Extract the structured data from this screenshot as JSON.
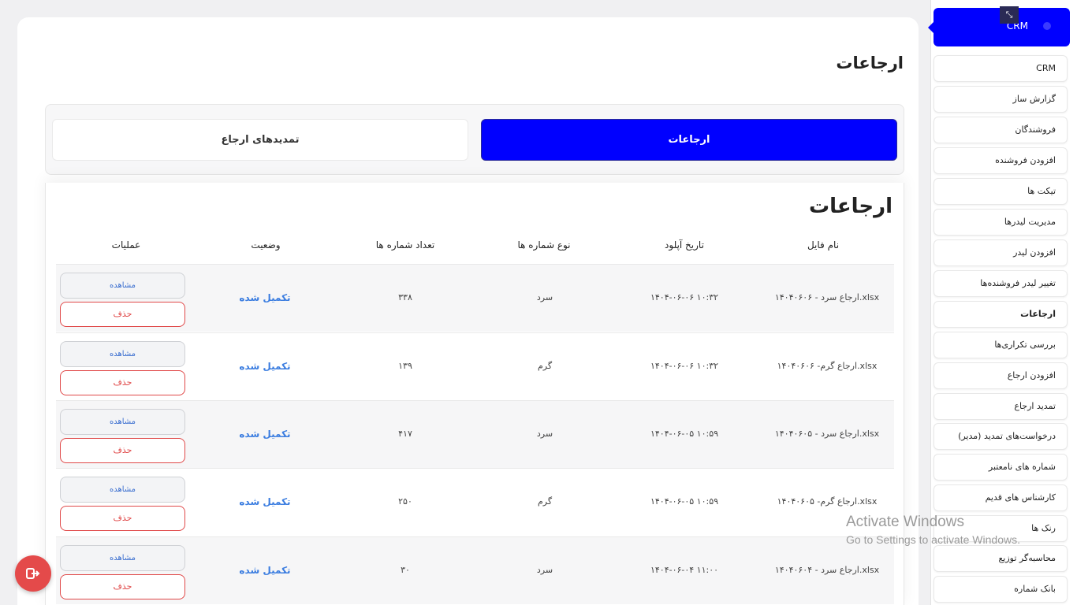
{
  "sidebar": {
    "header_label": "CRM",
    "items": [
      {
        "label": "CRM",
        "active": false
      },
      {
        "label": "گزارش ساز",
        "active": false
      },
      {
        "label": "فروشندگان",
        "active": false
      },
      {
        "label": "افزودن فروشنده",
        "active": false
      },
      {
        "label": "تیکت ها",
        "active": false
      },
      {
        "label": "مدیریت لیدرها",
        "active": false
      },
      {
        "label": "افزودن لیدر",
        "active": false
      },
      {
        "label": "تغییر لیدر فروشنده‌ها",
        "active": false
      },
      {
        "label": "ارجاعات",
        "active": true
      },
      {
        "label": "بررسی تکراری‌ها",
        "active": false
      },
      {
        "label": "افزودن ارجاع",
        "active": false
      },
      {
        "label": "تمدید ارجاع",
        "active": false
      },
      {
        "label": "درخواست‌های تمدید (مدیر)",
        "active": false
      },
      {
        "label": "شماره های نامعتبر",
        "active": false
      },
      {
        "label": "کارشناس های قدیم",
        "active": false
      },
      {
        "label": "رنک ها",
        "active": false
      },
      {
        "label": "محاسبه‌گر توزیع",
        "active": false
      },
      {
        "label": "بانک شماره",
        "active": false
      }
    ]
  },
  "page": {
    "title": "ارجاعات"
  },
  "tabs": {
    "active": "ارجاعات",
    "inactive": "تمدیدهای ارجاع"
  },
  "table": {
    "title": "ارجاعات",
    "headers": {
      "file_name": "نام فایل",
      "upload_date": "تاریخ آپلود",
      "number_type": "نوع شماره ها",
      "number_count": "تعداد شماره ها",
      "status": "وضعیت",
      "actions": "عملیات"
    },
    "rows": [
      {
        "file_name": "ارجاع سرد - ۱۴۰۴۰۶۰۶.xlsx",
        "upload_date": "۱۴۰۴-۰۶-۰۶ ۱۰:۳۲",
        "number_type": "سرد",
        "number_count": "۳۳۸",
        "status": "تکمیل شده",
        "view": "مشاهده",
        "delete": "حذف"
      },
      {
        "file_name": "ارجاع گرم- ۱۴۰۴۰۶۰۶.xlsx",
        "upload_date": "۱۴۰۴-۰۶-۰۶ ۱۰:۳۲",
        "number_type": "گرم",
        "number_count": "۱۳۹",
        "status": "تکمیل شده",
        "view": "مشاهده",
        "delete": "حذف"
      },
      {
        "file_name": "ارجاع سرد - ۱۴۰۴۰۶۰۵.xlsx",
        "upload_date": "۱۴۰۴-۰۶-۰۵ ۱۰:۵۹",
        "number_type": "سرد",
        "number_count": "۴۱۷",
        "status": "تکمیل شده",
        "view": "مشاهده",
        "delete": "حذف"
      },
      {
        "file_name": "ارجاع گرم- ۱۴۰۴۰۶۰۵.xlsx",
        "upload_date": "۱۴۰۴-۰۶-۰۵ ۱۰:۵۹",
        "number_type": "گرم",
        "number_count": "۲۵۰",
        "status": "تکمیل شده",
        "view": "مشاهده",
        "delete": "حذف"
      },
      {
        "file_name": "ارجاع سرد - ۱۴۰۴۰۶۰۴.xlsx",
        "upload_date": "۱۴۰۴-۰۶-۰۴ ۱۱:۰۰",
        "number_type": "سرد",
        "number_count": "۳۰",
        "status": "تکمیل شده",
        "view": "مشاهده",
        "delete": "حذف"
      }
    ]
  },
  "watermark": {
    "line1": "Activate Windows",
    "line2": "Go to Settings to activate Windows."
  },
  "colors": {
    "primary": "#0000ff",
    "status": "#3b7de0",
    "danger": "#e04848"
  }
}
